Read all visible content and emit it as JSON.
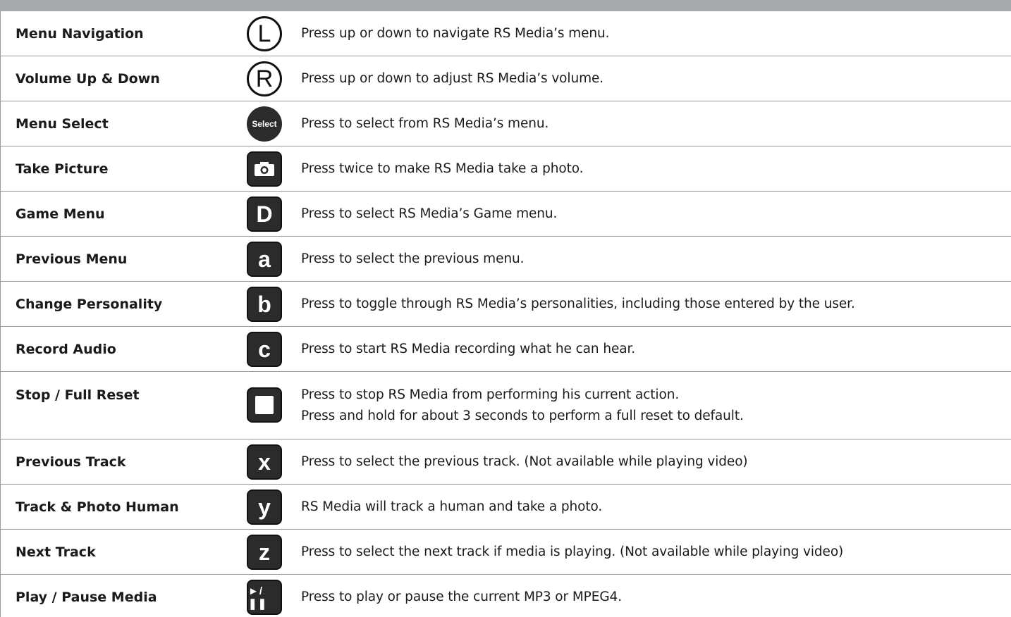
{
  "rows": [
    {
      "label": "Menu Navigation",
      "icon": "L",
      "icon_name": "l-button-icon",
      "desc1": "Press up or down to navigate RS Media’s menu."
    },
    {
      "label": "Volume Up & Down",
      "icon": "R",
      "icon_name": "r-button-icon",
      "desc1": "Press up or down to adjust RS Media’s volume."
    },
    {
      "label": "Menu Select",
      "icon": "Select",
      "icon_name": "select-button-icon",
      "desc1": "Press to select from RS Media’s menu."
    },
    {
      "label": "Take Picture",
      "icon": "",
      "icon_name": "camera-icon",
      "desc1": "Press twice to make RS Media take a photo."
    },
    {
      "label": "Game Menu",
      "icon": "D",
      "icon_name": "d-button-icon",
      "desc1": "Press to select RS Media’s Game menu."
    },
    {
      "label": "Previous Menu",
      "icon": "a",
      "icon_name": "a-button-icon",
      "desc1": "Press to select the previous menu."
    },
    {
      "label": "Change Personality",
      "icon": "b",
      "icon_name": "b-button-icon",
      "desc1": "Press to toggle through RS Media’s personalities, including  those entered by the user."
    },
    {
      "label": "Record Audio",
      "icon": "c",
      "icon_name": "c-button-icon",
      "desc1": "Press to start RS Media recording what he can hear."
    },
    {
      "label": "Stop / Full Reset",
      "icon": "",
      "icon_name": "stop-icon",
      "desc1": "Press to stop RS Media from performing his current action.",
      "desc2": "Press and hold for about 3 seconds to perform a full reset to default."
    },
    {
      "label": "Previous  Track",
      "icon": "x",
      "icon_name": "x-button-icon",
      "desc1": "Press to select the previous track. (Not available while playing video)"
    },
    {
      "label": "Track & Photo Human",
      "icon": "y",
      "icon_name": "y-button-icon",
      "desc1": "RS Media will track a human and take a photo."
    },
    {
      "label": "Next Track",
      "icon": "z",
      "icon_name": "z-button-icon",
      "desc1": "Press to select the next track if media is playing. (Not available while playing video)"
    },
    {
      "label": "Play / Pause Media",
      "icon": "►/❚❚",
      "icon_name": "play-pause-icon",
      "desc1": "Press to play or pause the current MP3 or MPEG4."
    }
  ],
  "colors": {
    "header_bar": "#a7a9ac",
    "rule": "#9a9a9a",
    "key_fill": "#2b2b2b"
  }
}
